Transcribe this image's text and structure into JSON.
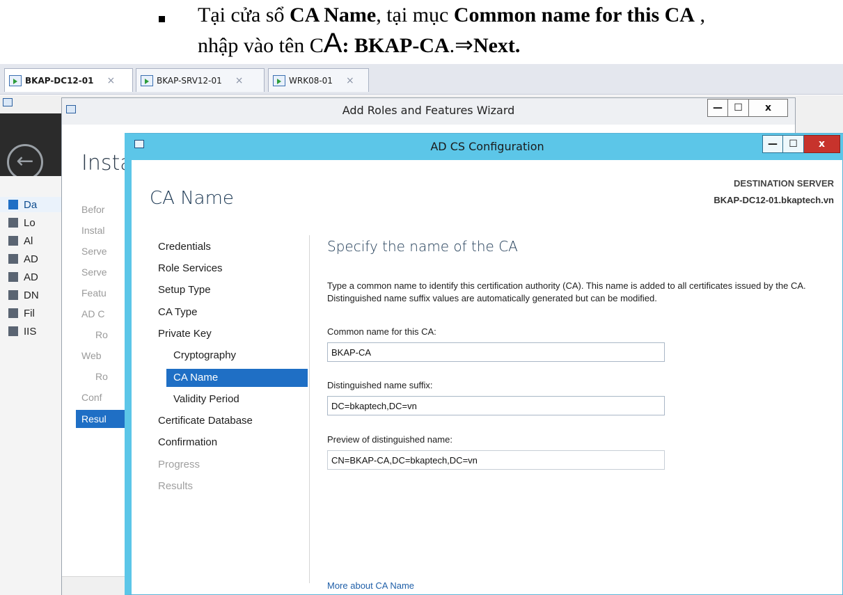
{
  "caption": {
    "line1_prefix": "Tại cửa sổ ",
    "line1_bold1": "CA Name",
    "line1_mid": ", tại mục ",
    "line1_bold2": "Common name for this CA",
    "line1_suffix": " ,",
    "line2_prefix": "nhập vào  tên C",
    "line2_bigA": "A",
    "line2_colon": ":",
    "line2_bold": " BKAP-CA",
    "line2_dot": ".",
    "line2_arrow": "⇒",
    "line2_next": "Next."
  },
  "vm_tabs": [
    {
      "label": "BKAP-DC12-01",
      "close": "×"
    },
    {
      "label": "BKAP-SRV12-01",
      "close": "×"
    },
    {
      "label": "WRK08-01",
      "close": "×"
    }
  ],
  "server_manager": {
    "back_glyph": "←",
    "nav": [
      {
        "label": "Da",
        "icon": "dashboard-icon"
      },
      {
        "label": "Lo",
        "icon": "local-server-icon"
      },
      {
        "label": "Al",
        "icon": "all-servers-icon"
      },
      {
        "label": "AD",
        "icon": "ad-cs-icon"
      },
      {
        "label": "AD",
        "icon": "ad-ds-icon"
      },
      {
        "label": "DN",
        "icon": "dns-icon"
      },
      {
        "label": "Fil",
        "icon": "file-services-icon"
      },
      {
        "label": "IIS",
        "icon": "iis-icon"
      }
    ]
  },
  "add_roles_wizard": {
    "title": "Add Roles and Features Wizard",
    "heading": "Insta",
    "btn_min": "—",
    "btn_max": "☐",
    "btn_close": "x",
    "steps": [
      "Befor",
      "Instal",
      "Serve",
      "Serve",
      "Featu",
      "AD C",
      "Ro",
      "Web",
      "Ro",
      "Conf",
      "Resul"
    ]
  },
  "adcs_dialog": {
    "title": "AD CS Configuration",
    "btn_min": "—",
    "btn_max": "☐",
    "btn_close": "x",
    "destination_label": "DESTINATION SERVER",
    "destination_server": "BKAP-DC12-01.bkaptech.vn",
    "page_heading": "CA Name",
    "steps": [
      {
        "label": "Credentials",
        "state": "normal"
      },
      {
        "label": "Role Services",
        "state": "normal"
      },
      {
        "label": "Setup Type",
        "state": "normal"
      },
      {
        "label": "CA Type",
        "state": "normal"
      },
      {
        "label": "Private Key",
        "state": "normal"
      },
      {
        "label": "Cryptography",
        "state": "sub"
      },
      {
        "label": "CA Name",
        "state": "active"
      },
      {
        "label": "Validity Period",
        "state": "sub"
      },
      {
        "label": "Certificate Database",
        "state": "normal"
      },
      {
        "label": "Confirmation",
        "state": "normal"
      },
      {
        "label": "Progress",
        "state": "disabled"
      },
      {
        "label": "Results",
        "state": "disabled"
      }
    ],
    "content_heading": "Specify the name of the CA",
    "description": "Type a common name to identify this certification authority (CA). This name is added to all certificates issued by the CA. Distinguished name suffix values are automatically generated but can be modified.",
    "common_name_label": "Common name for this CA:",
    "common_name_value": "BKAP-CA",
    "dn_suffix_label": "Distinguished name suffix:",
    "dn_suffix_value": "DC=bkaptech,DC=vn",
    "preview_label": "Preview of distinguished name:",
    "preview_value": "CN=BKAP-CA,DC=bkaptech,DC=vn",
    "more_link": "More about CA Name"
  }
}
